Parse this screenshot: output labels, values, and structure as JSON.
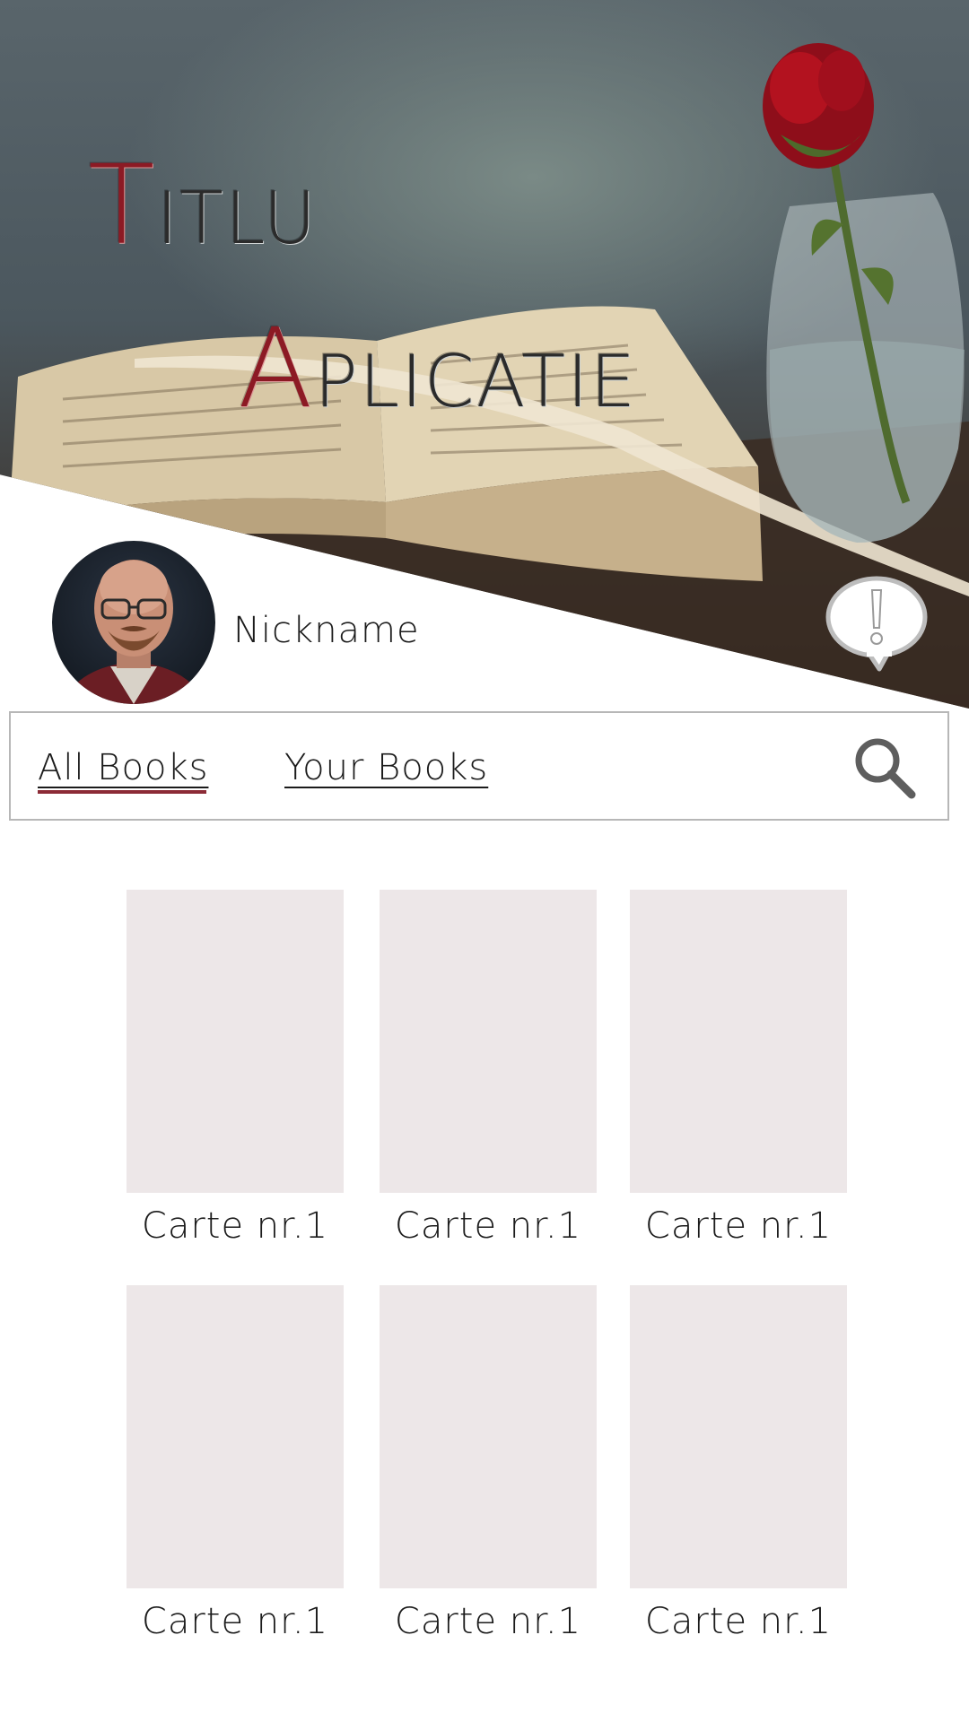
{
  "app": {
    "title_line1": {
      "cap": "T",
      "rest": "ITLU"
    },
    "title_line2": {
      "cap": "A",
      "rest": "PLICATIE"
    }
  },
  "profile": {
    "nickname": "Nickname"
  },
  "tabs": [
    {
      "label": "All Books",
      "active": true
    },
    {
      "label": "Your Books",
      "active": false
    }
  ],
  "books": [
    {
      "label": "Carte nr.1"
    },
    {
      "label": "Carte nr.1"
    },
    {
      "label": "Carte nr.1"
    },
    {
      "label": "Carte nr.1"
    },
    {
      "label": "Carte nr.1"
    },
    {
      "label": "Carte nr.1"
    }
  ],
  "icons": {
    "alert": "exclamation-bubble-icon",
    "search": "search-icon"
  },
  "colors": {
    "accent": "#8c1a24",
    "tab_underline": "#8c2b36",
    "book_placeholder": "#ede7e8",
    "border": "#b7b7b7"
  }
}
